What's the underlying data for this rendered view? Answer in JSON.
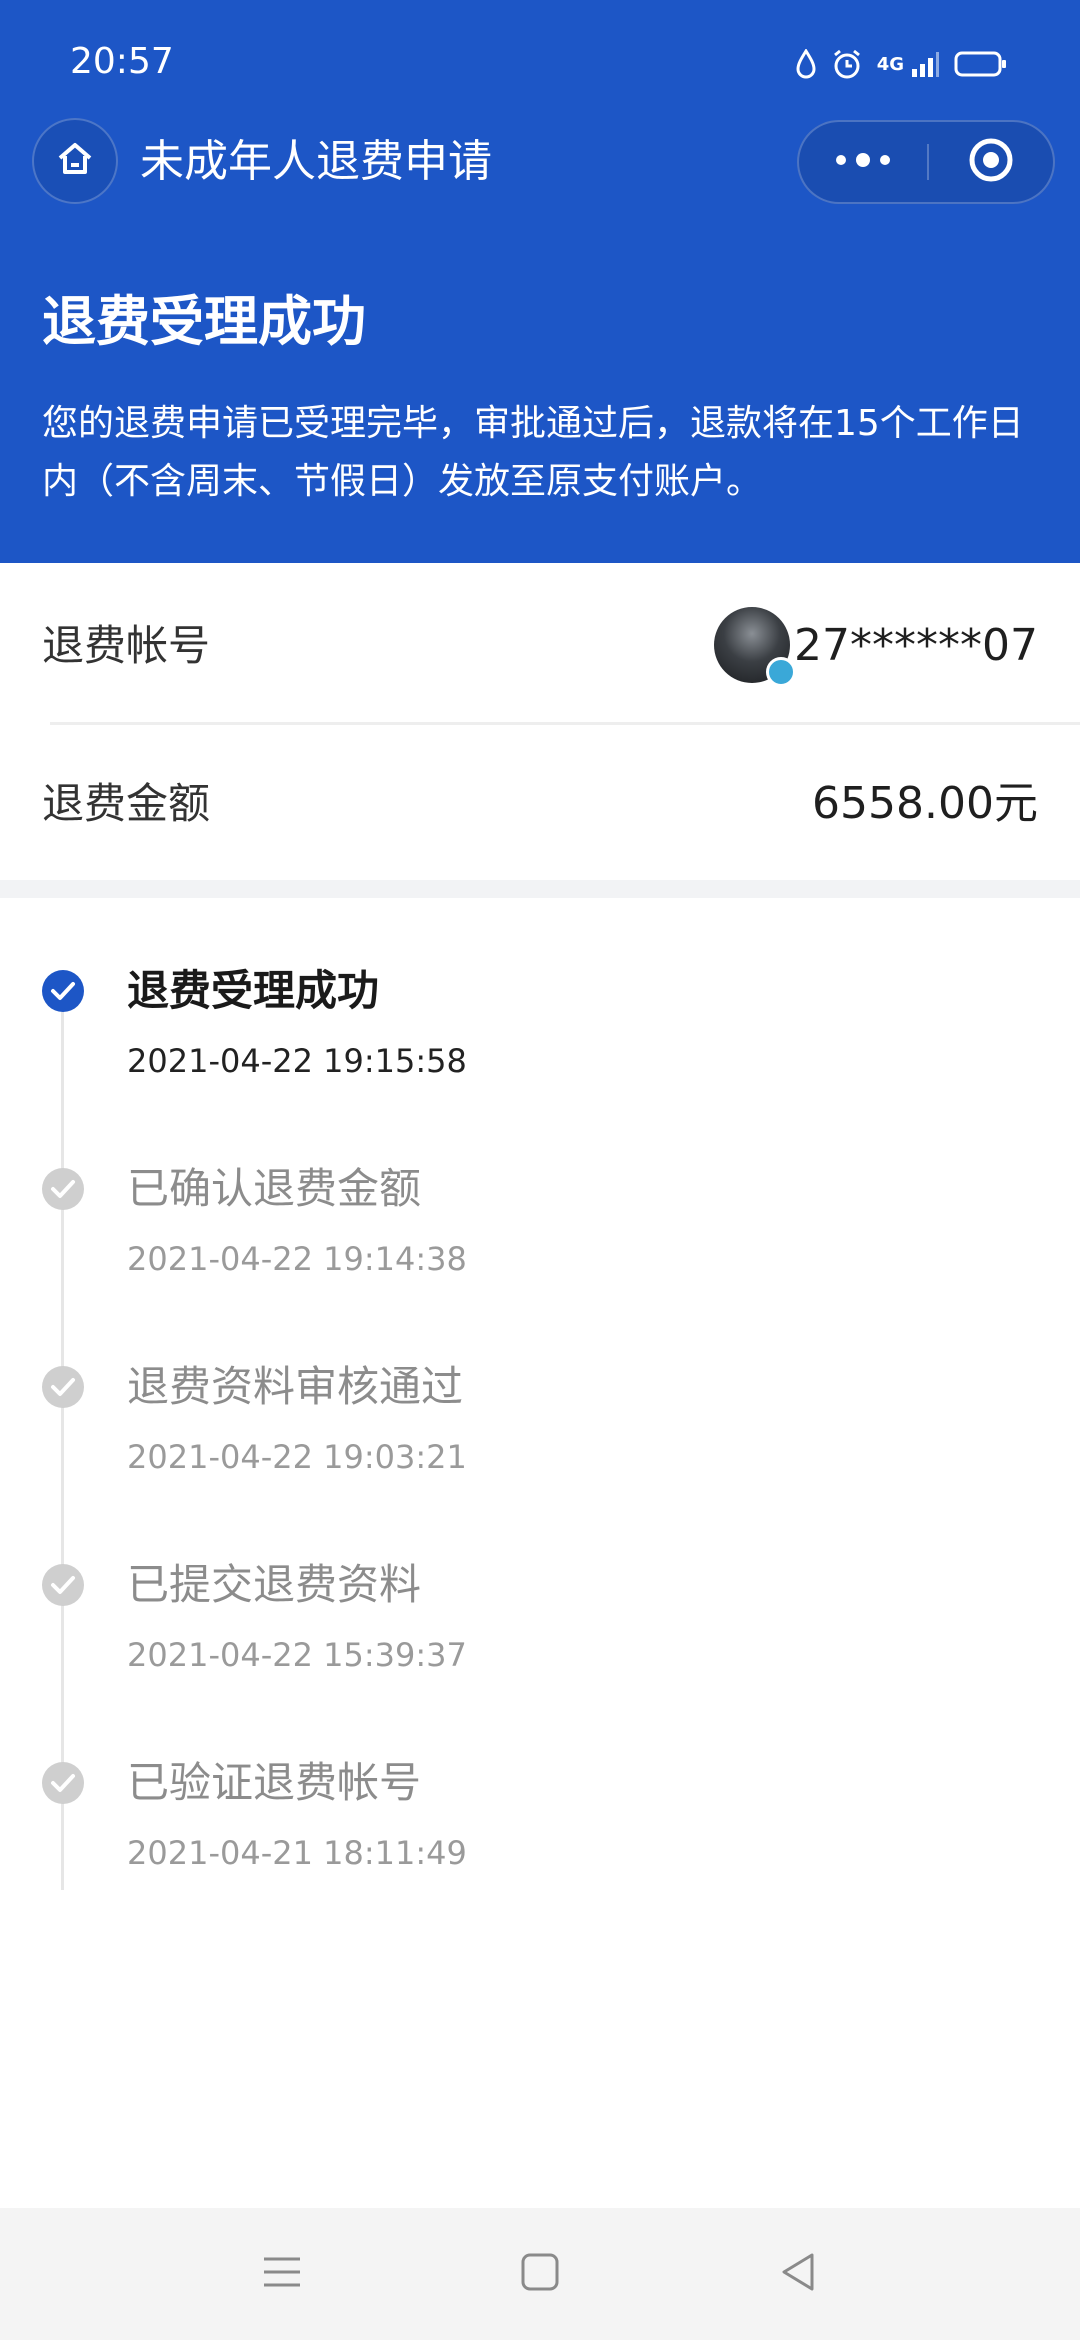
{
  "status_bar": {
    "time": "20:57",
    "network": "4G"
  },
  "nav": {
    "title": "未成年人退费申请"
  },
  "result": {
    "title": "退费受理成功",
    "description": "您的退费申请已受理完毕，审批通过后，退款将在15个工作日内（不含周末、节假日）发放至原支付账户。"
  },
  "info": {
    "account_label": "退费帐号",
    "account_value": "27******07",
    "amount_label": "退费金额",
    "amount_value": "6558.00元"
  },
  "timeline": [
    {
      "title": "退费受理成功",
      "time": "2021-04-22 19:15:58",
      "state": "active"
    },
    {
      "title": "已确认退费金额",
      "time": "2021-04-22 19:14:38",
      "state": "done"
    },
    {
      "title": "退费资料审核通过",
      "time": "2021-04-22 19:03:21",
      "state": "done"
    },
    {
      "title": "已提交退费资料",
      "time": "2021-04-22 15:39:37",
      "state": "done"
    },
    {
      "title": "已验证退费帐号",
      "time": "2021-04-21 18:11:49",
      "state": "done"
    }
  ],
  "colors": {
    "header_blue": "#1d56c6",
    "active_blue": "#1d56c6",
    "done_gray": "#c8c8c8"
  },
  "icons": {
    "home": "home-icon",
    "more": "more-dots-icon",
    "close": "close-circle-icon",
    "check": "check-icon",
    "menu": "menu-icon",
    "square": "home-square-icon",
    "back": "back-triangle-icon"
  }
}
